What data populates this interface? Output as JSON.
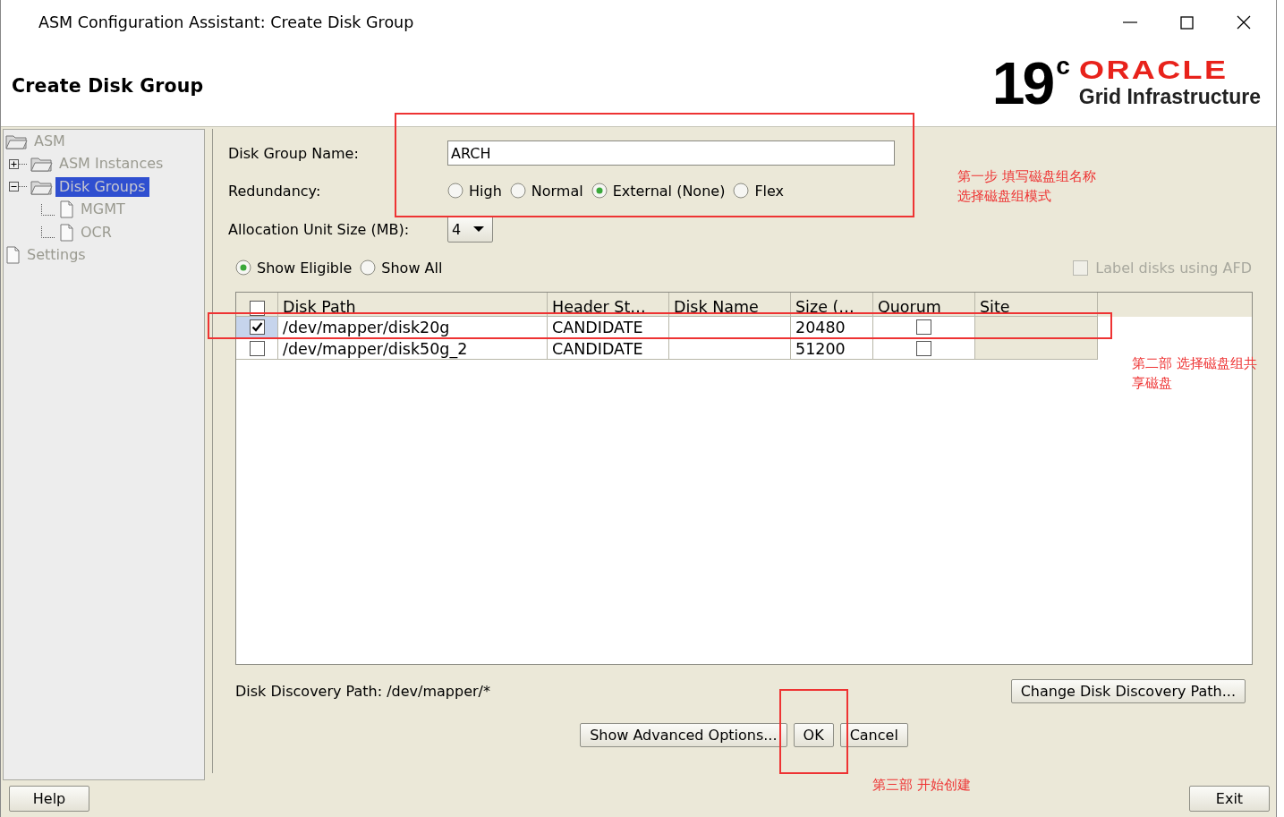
{
  "window": {
    "title": "ASM Configuration Assistant: Create Disk Group"
  },
  "header": {
    "title": "Create Disk Group",
    "logo": {
      "version": "19",
      "superscript": "c",
      "brand": "ORACLE",
      "product": "Grid Infrastructure"
    }
  },
  "tree": [
    {
      "label": "ASM",
      "kind": "folder",
      "selected": false,
      "children": [
        {
          "label": "ASM Instances",
          "kind": "folder",
          "expanded": false,
          "selected": false
        },
        {
          "label": "Disk Groups",
          "kind": "folder",
          "expanded": true,
          "selected": true,
          "children": [
            {
              "label": "MGMT",
              "kind": "file",
              "selected": false
            },
            {
              "label": "OCR",
              "kind": "file",
              "selected": false
            }
          ]
        }
      ]
    },
    {
      "label": "Settings",
      "kind": "file",
      "selected": false
    }
  ],
  "form": {
    "disk_group_name": {
      "label": "Disk Group Name:",
      "value": "ARCH"
    },
    "redundancy": {
      "label": "Redundancy:",
      "options": [
        {
          "label": "High",
          "selected": false
        },
        {
          "label": "Normal",
          "selected": false
        },
        {
          "label": "External (None)",
          "selected": true
        },
        {
          "label": "Flex",
          "selected": false
        }
      ]
    },
    "allocation_unit_size": {
      "label": "Allocation Unit Size (MB):",
      "value": "4"
    },
    "filter": [
      {
        "label": "Show Eligible",
        "selected": true
      },
      {
        "label": "Show All",
        "selected": false
      }
    ],
    "label_disks_afd": {
      "label": "Label disks using AFD",
      "checked": false,
      "disabled": true
    }
  },
  "table": {
    "select_all": {
      "checked": false
    },
    "columns": [
      "Disk Path",
      "Header St…",
      "Disk Name",
      "Size (…",
      "Quorum",
      "Site"
    ],
    "rows": [
      {
        "checked": true,
        "path": "/dev/mapper/disk20g",
        "header_status": "CANDIDATE",
        "size": "20480",
        "quorum": false
      },
      {
        "checked": false,
        "path": "/dev/mapper/disk50g_2",
        "header_status": "CANDIDATE",
        "size": "51200",
        "quorum": false
      }
    ]
  },
  "discovery": {
    "label": "Disk Discovery Path: /dev/mapper/*",
    "button": "Change Disk Discovery Path..."
  },
  "actions": [
    "Show Advanced Options...",
    "OK",
    "Cancel"
  ],
  "bottom": {
    "help": "Help",
    "exit": "Exit"
  },
  "annotations": [
    {
      "lines": [
        "第一步 填写磁盘组名称",
        "选择磁盘组模式"
      ]
    },
    {
      "lines": [
        "第二部 选择磁盘组共",
        "享磁盘"
      ]
    },
    {
      "lines": [
        "第三部 开始创建"
      ]
    }
  ]
}
